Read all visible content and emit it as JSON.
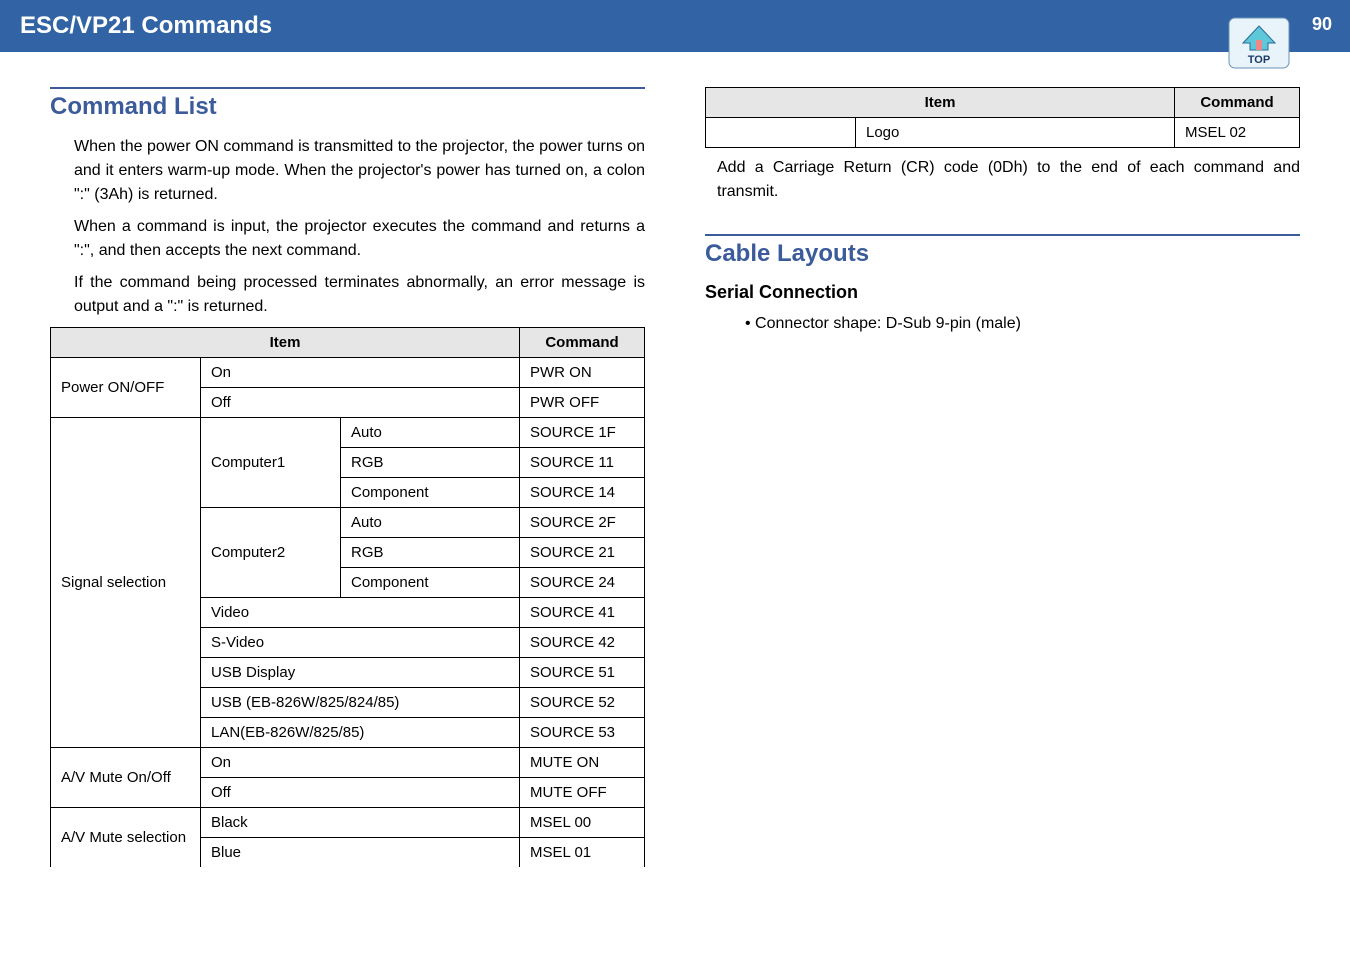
{
  "header": {
    "title": "ESC/VP21 Commands",
    "page_number": "90",
    "icon_label": "TOP"
  },
  "left": {
    "heading": "Command List",
    "p1": "When the power ON command is transmitted to the projector, the power turns on and it enters warm-up mode. When the projector's power has turned on, a colon \":\" (3Ah) is returned.",
    "p2": "When a command is input, the projector executes the command and returns a \":\", and then accepts the next command.",
    "p3": "If the command being processed terminates abnormally, an error message is output and a \":\" is returned.",
    "th_item": "Item",
    "th_cmd": "Command",
    "rows": {
      "power": "Power ON/OFF",
      "on": "On",
      "off": "Off",
      "pwron": "PWR ON",
      "pwroff": "PWR OFF",
      "sig": "Signal selection",
      "c1": "Computer1",
      "c2": "Computer2",
      "auto": "Auto",
      "rgb": "RGB",
      "comp": "Component",
      "s1f": "SOURCE 1F",
      "s11": "SOURCE 11",
      "s14": "SOURCE 14",
      "s2f": "SOURCE 2F",
      "s21": "SOURCE 21",
      "s24": "SOURCE 24",
      "video": "Video",
      "s41": "SOURCE 41",
      "svideo": "S-Video",
      "s42": "SOURCE 42",
      "usbdisp": "USB Display",
      "s51": "SOURCE 51",
      "usbeb": "USB (EB-826W/825/824/85)",
      "s52": "SOURCE 52",
      "lan": "LAN(EB-826W/825/85)",
      "s53": "SOURCE 53",
      "avmute": "A/V Mute On/Off",
      "muteon": "MUTE ON",
      "muteoff": "MUTE OFF",
      "avmsel": "A/V Mute selection",
      "black": "Black",
      "blue": "Blue",
      "m00": "MSEL 00",
      "m01": "MSEL 01"
    }
  },
  "right": {
    "th_item": "Item",
    "th_cmd": "Command",
    "logo": "Logo",
    "m02": "MSEL 02",
    "note": "Add a Carriage Return (CR) code (0Dh) to the end of each command and transmit.",
    "heading": "Cable Layouts",
    "sub": "Serial Connection",
    "bullet": "Connector shape: D-Sub 9-pin (male)"
  }
}
